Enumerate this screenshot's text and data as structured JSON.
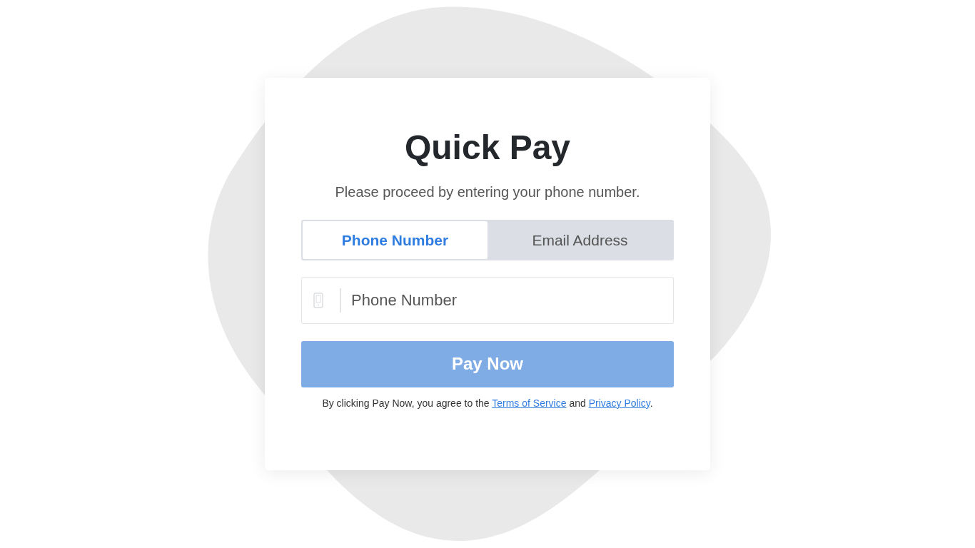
{
  "title": "Quick Pay",
  "subtitle": "Please proceed by entering your phone number.",
  "tabs": [
    {
      "label": "Phone Number",
      "selected": true
    },
    {
      "label": "Email Address",
      "selected": false
    }
  ],
  "field": {
    "placeholder": "Phone Number"
  },
  "button": {
    "label": "Pay Now",
    "disabled": true
  },
  "legal": [
    {
      "kind": "text",
      "text": "By clicking Pay Now, you agree to the "
    },
    {
      "kind": "link",
      "text": "Terms of Service"
    },
    {
      "kind": "text",
      "text": " and "
    },
    {
      "kind": "link",
      "text": "Privacy Policy"
    },
    {
      "kind": "text",
      "text": "."
    }
  ]
}
